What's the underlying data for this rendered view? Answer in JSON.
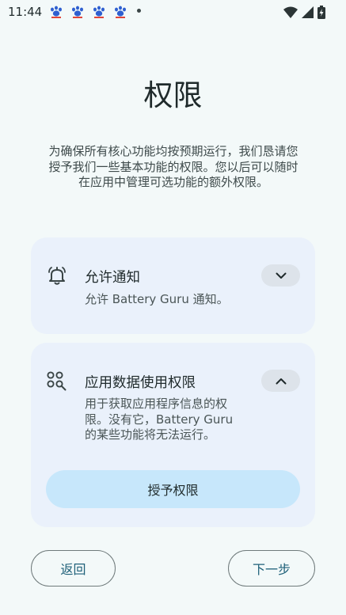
{
  "status_bar": {
    "time": "11:44",
    "notification_icons": [
      "baidu-paw-icon",
      "baidu-paw-icon",
      "baidu-paw-icon",
      "baidu-paw-icon"
    ]
  },
  "page": {
    "title": "权限",
    "intro_lines": [
      "为确保所有核心功能均按预期运行，我们恳请您",
      "授予我们一些基本功能的权限。您以后可以随时",
      "在应用中管理可选功能的额外权限。"
    ]
  },
  "permissions": [
    {
      "icon": "bell-icon",
      "title": "允许通知",
      "description_lines": [
        "允许 Battery Guru 通知。"
      ],
      "expanded": false
    },
    {
      "icon": "app-usage-icon",
      "title": "应用数据使用权限",
      "description_lines": [
        "用于获取应用程序信息的权",
        "限。没有它，Battery Guru",
        "的某些功能将无法运行。"
      ],
      "expanded": true,
      "action_label": "授予权限"
    }
  ],
  "footer": {
    "back_label": "返回",
    "next_label": "下一步"
  },
  "colors": {
    "background": "#f3f9f9",
    "card": "#eaf1fb",
    "grant_button": "#c7e7fb",
    "nav_text": "#1e6079"
  }
}
